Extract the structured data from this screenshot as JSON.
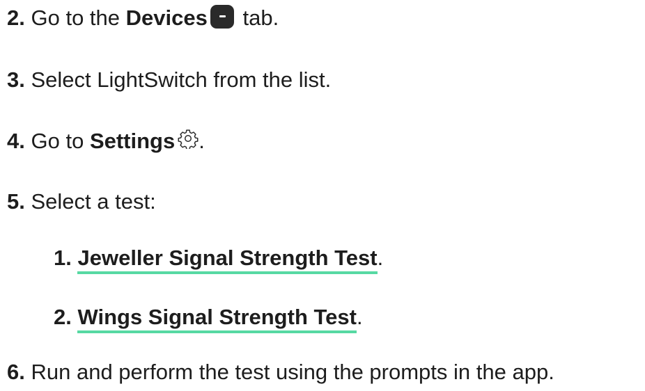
{
  "steps": [
    {
      "num": "2.",
      "pre": "Go to the",
      "bold": "Devices",
      "post": "tab.",
      "icon": "devices-tab-icon"
    },
    {
      "num": "3.",
      "text": "Select LightSwitch from the list."
    },
    {
      "num": "4.",
      "pre": "Go to",
      "bold": "Settings",
      "post": ".",
      "icon": "gear-icon"
    },
    {
      "num": "5.",
      "text": "Select a test:"
    },
    {
      "num": "6.",
      "text": "Run and perform the test using the prompts in the app."
    }
  ],
  "subtests": [
    {
      "num": "1.",
      "label": "Jeweller Signal Strength Test",
      "post": "."
    },
    {
      "num": "2.",
      "label": "Wings Signal Strength Test",
      "post": "."
    }
  ],
  "colors": {
    "link_underline": "#57d9a3",
    "text": "#1d1d1d",
    "icon_bg": "#2a2a2a"
  }
}
